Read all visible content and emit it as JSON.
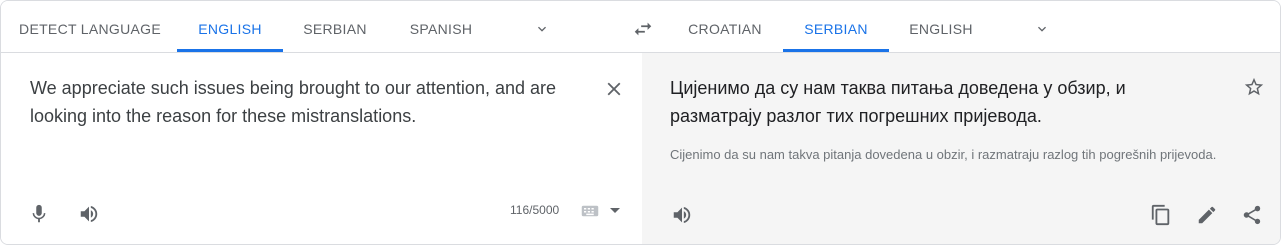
{
  "source_languages": {
    "tabs": [
      {
        "label": "DETECT LANGUAGE",
        "active": false
      },
      {
        "label": "ENGLISH",
        "active": true
      },
      {
        "label": "SERBIAN",
        "active": false
      },
      {
        "label": "SPANISH",
        "active": false
      }
    ],
    "more_icon": "chevron-down-icon"
  },
  "swap_icon": "swap-arrows-icon",
  "target_languages": {
    "tabs": [
      {
        "label": "CROATIAN",
        "active": false
      },
      {
        "label": "SERBIAN",
        "active": true
      },
      {
        "label": "ENGLISH",
        "active": false
      }
    ],
    "more_icon": "chevron-down-icon"
  },
  "source": {
    "text": "We appreciate such issues being brought to our attention, and are looking into the reason for these mistranslations.",
    "char_count": "116/5000",
    "icons": [
      "close-icon",
      "microphone-icon",
      "speaker-icon",
      "keyboard-icon",
      "caret-down-icon"
    ]
  },
  "target": {
    "text": "Цијенимо да су нам таква питања доведена у обзир, и разматрају разлог тих погрешних пријевода.",
    "transliteration": "Cijenimo da su nam takva pitanja dovedena u obzir, i razmatraju razlog tih pogrešnih prijevoda.",
    "icons": [
      "star-icon",
      "speaker-icon",
      "copy-icon",
      "pencil-icon",
      "share-icon"
    ]
  },
  "colors": {
    "accent": "#1a73e8",
    "text": "#3c4043",
    "muted": "#5f6368",
    "target_bg": "#f5f5f5",
    "border": "#dadce0"
  }
}
